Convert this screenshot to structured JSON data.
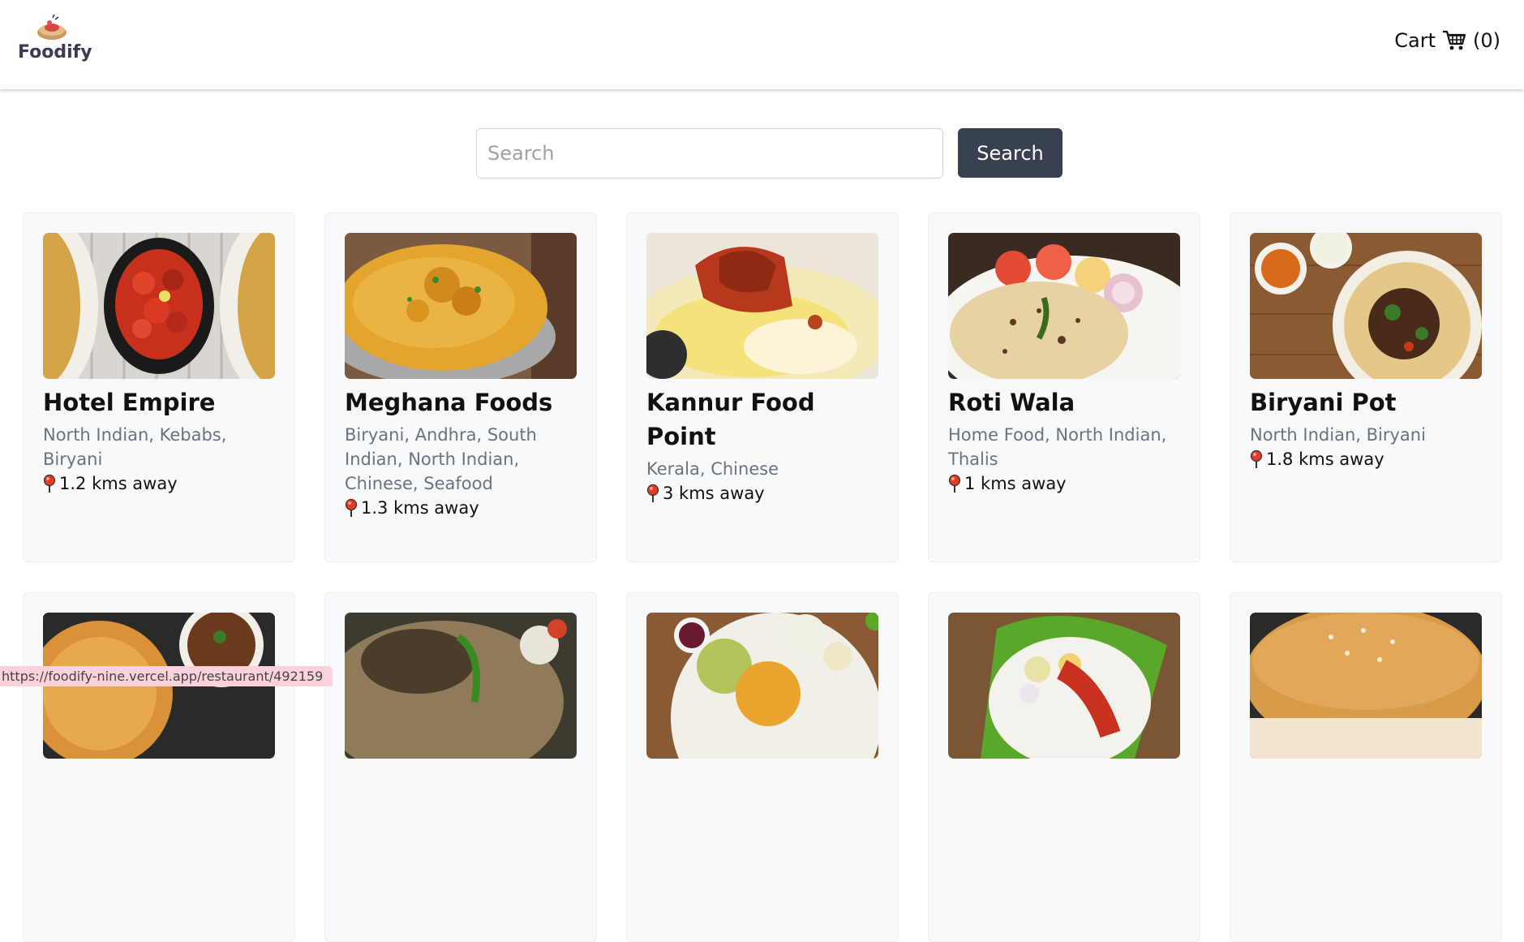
{
  "header": {
    "logo_text": "Foodify",
    "cart_label": "Cart",
    "cart_count": "(0)"
  },
  "search": {
    "placeholder": "Search",
    "button_label": "Search"
  },
  "restaurants": [
    {
      "name": "Hotel Empire",
      "cuisines": "North Indian, Kebabs, Biryani",
      "distance": "1.2 kms away"
    },
    {
      "name": "Meghana Foods",
      "cuisines": "Biryani, Andhra, South Indian, North Indian, Chinese, Seafood",
      "distance": "1.3 kms away"
    },
    {
      "name": "Kannur Food Point",
      "cuisines": "Kerala, Chinese",
      "distance": "3 kms away"
    },
    {
      "name": "Roti Wala",
      "cuisines": "Home Food, North Indian, Thalis",
      "distance": "1 kms away"
    },
    {
      "name": "Biryani Pot",
      "cuisines": "North Indian, Biryani",
      "distance": "1.8 kms away"
    }
  ],
  "status_bar": {
    "url": "https://foodify-nine.vercel.app/restaurant/492159"
  }
}
